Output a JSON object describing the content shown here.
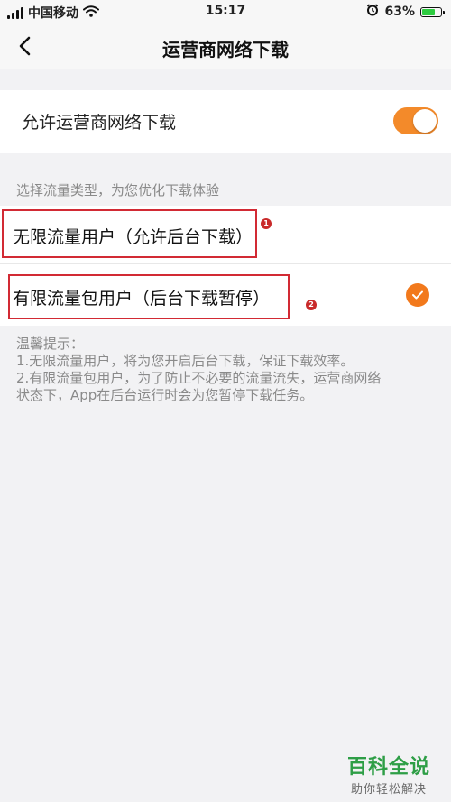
{
  "status_bar": {
    "carrier": "中国移动",
    "time": "15:17",
    "battery": "63%",
    "battery_level": 63,
    "icons": [
      "signal-icon",
      "wifi-icon",
      "alarm-icon",
      "battery-icon"
    ]
  },
  "nav": {
    "title": "运营商网络下载",
    "back_icon": "chevron-left-icon"
  },
  "settings": {
    "allow_label": "允许运营商网络下载",
    "allow_enabled": true,
    "toggle_color": "#f38a2a"
  },
  "section_hint": "选择流量类型，为您优化下载体验",
  "options": [
    {
      "label": "无限流量用户（允许后台下载）",
      "selected": false,
      "marker": "1"
    },
    {
      "label": "有限流量包用户（后台下载暂停）",
      "selected": true,
      "marker": "2"
    }
  ],
  "accent_color": "#f2791c",
  "annotation_color": "#d22a34",
  "tips": {
    "title": "温馨提示：",
    "line1": "1.无限流量用户，将为您开启后台下载，保证下载效率。",
    "line2a": "2.有限流量包用户，为了防止不必要的流量流失，运营商网络",
    "line2b": "状态下，App在后台运行时会为您暂停下载任务。"
  },
  "watermark": {
    "main": "百科全说",
    "sub": "助你轻松解决"
  }
}
